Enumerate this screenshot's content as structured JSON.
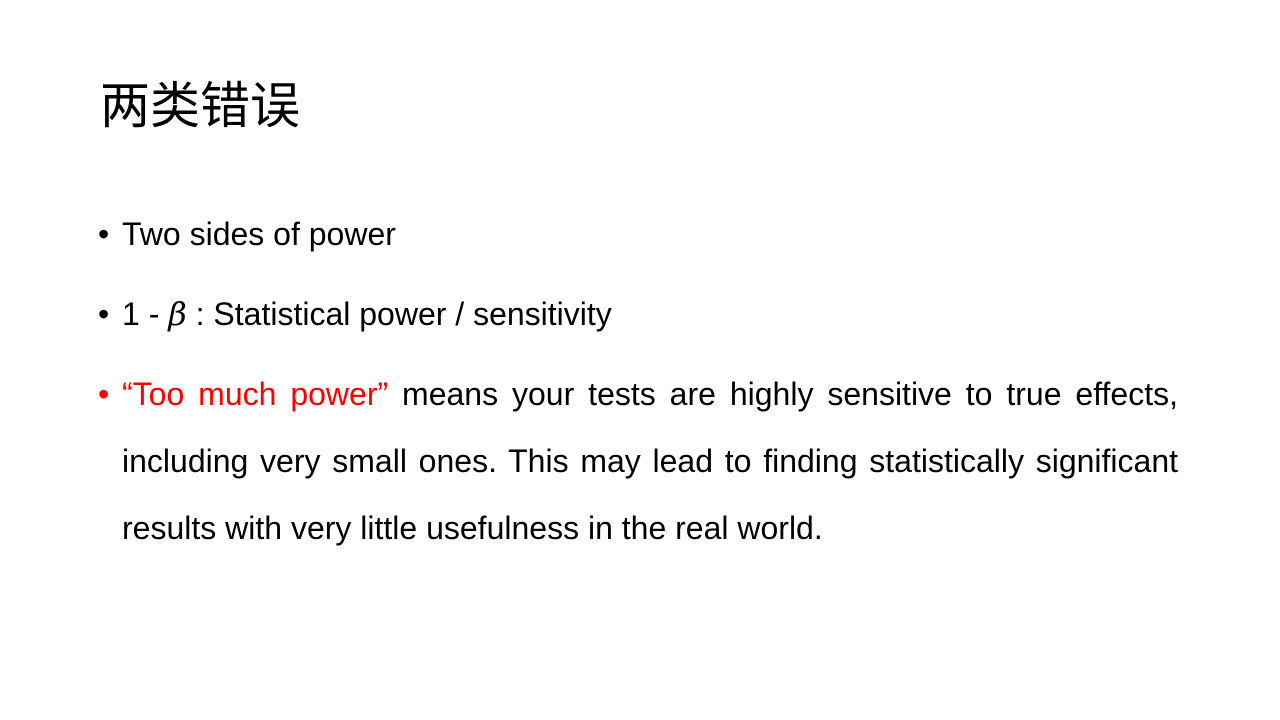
{
  "slide": {
    "title": "两类错误",
    "bullet_marker": "•",
    "bullets": [
      {
        "text": "Two sides of power"
      },
      {
        "prefix": "1 - ",
        "symbol": "β",
        "suffix": " : Statistical power / sensitivity"
      },
      {
        "highlight": "“Too much power”",
        "text": " means your tests are highly sensitive to true effects, including very small ones. This may lead to finding statistically significant results with very little usefulness in the real world."
      }
    ],
    "colors": {
      "background": "#ffffff",
      "text": "#000000",
      "highlight": "#ff0000"
    }
  }
}
